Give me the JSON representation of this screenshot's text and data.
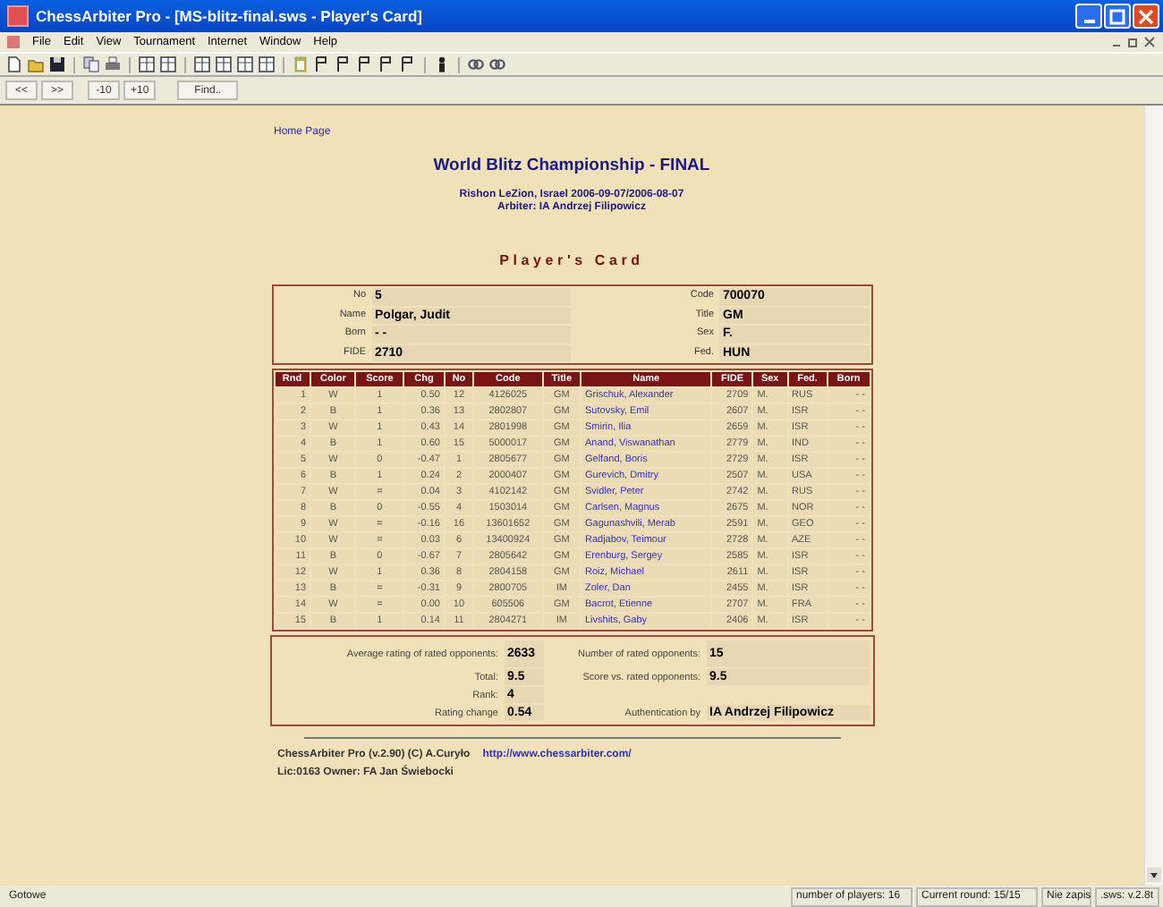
{
  "window": {
    "title": "ChessArbiter Pro - [MS-blitz-final.sws - Player's Card]"
  },
  "menu": [
    "File",
    "Edit",
    "View",
    "Tournament",
    "Internet",
    "Window",
    "Help"
  ],
  "nav_buttons": [
    "<<",
    ">>",
    "-10",
    "+10",
    "Find.."
  ],
  "page": {
    "home_link": "Home Page",
    "title": "World Blitz Championship - FINAL",
    "place": "Rishon LeZion, Israel 2006-09-07/2006-08-07",
    "arbiter": "Arbiter: IA Andrzej Filipowicz",
    "card_title": "Player's Card",
    "info_left": [
      {
        "label": "No",
        "value": "5"
      },
      {
        "label": "Name",
        "value": "Polgar, Judit"
      },
      {
        "label": "Born",
        "value": "- -"
      },
      {
        "label": "FIDE",
        "value": "2710"
      }
    ],
    "info_right": [
      {
        "label": "Code",
        "value": "700070"
      },
      {
        "label": "Title",
        "value": "GM"
      },
      {
        "label": "Sex",
        "value": "F."
      },
      {
        "label": "Fed.",
        "value": "HUN"
      }
    ],
    "table": {
      "columns": [
        "Rnd",
        "Color",
        "Score",
        "Chg",
        "No",
        "Code",
        "Title",
        "Name",
        "FIDE",
        "Sex",
        "Fed.",
        "Born"
      ],
      "rows": [
        [
          "1",
          "W",
          "1",
          "0.50",
          "12",
          "4126025",
          "GM",
          "Grischuk, Alexander",
          "2709",
          "M.",
          "RUS",
          "- -"
        ],
        [
          "2",
          "B",
          "1",
          "0.36",
          "13",
          "2802807",
          "GM",
          "Sutovsky, Emil",
          "2607",
          "M.",
          "ISR",
          "- -"
        ],
        [
          "3",
          "W",
          "1",
          "0.43",
          "14",
          "2801998",
          "GM",
          "Smirin, Ilia",
          "2659",
          "M.",
          "ISR",
          "- -"
        ],
        [
          "4",
          "B",
          "1",
          "0.60",
          "15",
          "5000017",
          "GM",
          "Anand, Viswanathan",
          "2779",
          "M.",
          "IND",
          "- -"
        ],
        [
          "5",
          "W",
          "0",
          "-0.47",
          "1",
          "2805677",
          "GM",
          "Gelfand, Boris",
          "2729",
          "M.",
          "ISR",
          "- -"
        ],
        [
          "6",
          "B",
          "1",
          "0.24",
          "2",
          "2000407",
          "GM",
          "Gurevich, Dmitry",
          "2507",
          "M.",
          "USA",
          "- -"
        ],
        [
          "7",
          "W",
          "=",
          "0.04",
          "3",
          "4102142",
          "GM",
          "Svidler, Peter",
          "2742",
          "M.",
          "RUS",
          "- -"
        ],
        [
          "8",
          "B",
          "0",
          "-0.55",
          "4",
          "1503014",
          "GM",
          "Carlsen, Magnus",
          "2675",
          "M.",
          "NOR",
          "- -"
        ],
        [
          "9",
          "W",
          "=",
          "-0.16",
          "16",
          "13601652",
          "GM",
          "Gagunashvili, Merab",
          "2591",
          "M.",
          "GEO",
          "- -"
        ],
        [
          "10",
          "W",
          "=",
          "0.03",
          "6",
          "13400924",
          "GM",
          "Radjabov, Teimour",
          "2728",
          "M.",
          "AZE",
          "- -"
        ],
        [
          "11",
          "B",
          "0",
          "-0.67",
          "7",
          "2805642",
          "GM",
          "Erenburg, Sergey",
          "2585",
          "M.",
          "ISR",
          "- -"
        ],
        [
          "12",
          "W",
          "1",
          "0.36",
          "8",
          "2804158",
          "GM",
          "Roiz, Michael",
          "2611",
          "M.",
          "ISR",
          "- -"
        ],
        [
          "13",
          "B",
          "=",
          "-0.31",
          "9",
          "2800705",
          "IM",
          "Zoler, Dan",
          "2455",
          "M.",
          "ISR",
          "- -"
        ],
        [
          "14",
          "W",
          "=",
          "0.00",
          "10",
          "605506",
          "GM",
          "Bacrot, Etienne",
          "2707",
          "M.",
          "FRA",
          "- -"
        ],
        [
          "15",
          "B",
          "1",
          "0.14",
          "11",
          "2804271",
          "IM",
          "Livshits, Gaby",
          "2406",
          "M.",
          "ISR",
          "- -"
        ]
      ]
    },
    "summary_left": [
      {
        "label": "Average rating of rated opponents:",
        "value": "2633"
      },
      {
        "label": "Total:",
        "value": "9.5"
      },
      {
        "label": "Rank:",
        "value": "4"
      },
      {
        "label": "Rating change",
        "value": "0.54"
      }
    ],
    "summary_right": [
      {
        "label": "Number of rated opponents:",
        "value": "15"
      },
      {
        "label": "Score vs. rated opponents:",
        "value": "9.5"
      },
      {
        "label": "Authentication by",
        "value": "IA Andrzej Filipowicz"
      }
    ],
    "footer_text": "ChessArbiter Pro (v.2.90) (C) A.Curyło",
    "footer_link": "http://www.chessarbiter.com/",
    "license": "Lic:0163 Owner: FA Jan Świebocki"
  },
  "status_bar": [
    "Gotowe",
    "number of players: 16",
    "Current round: 15/15",
    "Nie zapis",
    ".sws: v.2.8t"
  ]
}
